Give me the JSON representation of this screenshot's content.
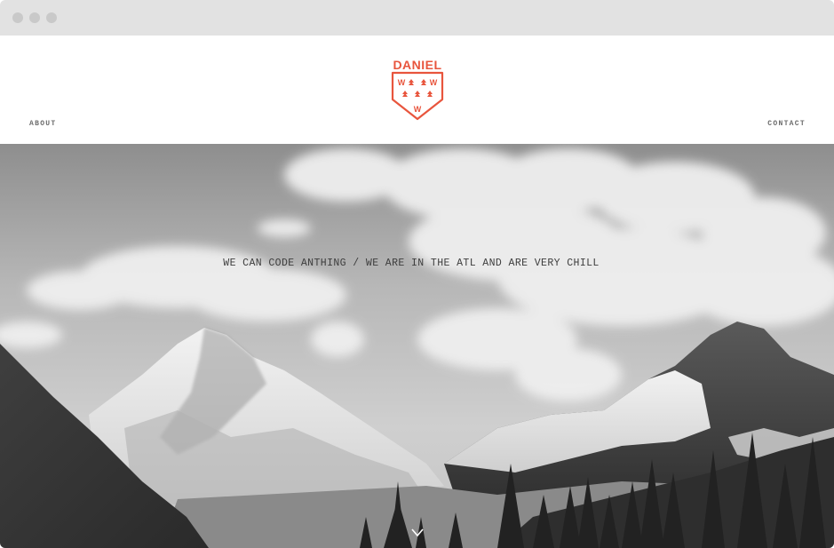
{
  "browser": {
    "controls": [
      "close",
      "minimize",
      "maximize"
    ]
  },
  "header": {
    "logo_text": "DANIEL",
    "logo_letters": [
      "W",
      "W",
      "W"
    ],
    "logo_color": "#e8553d",
    "nav_left": "ABOUT",
    "nav_right": "CONTACT"
  },
  "hero": {
    "tagline": "WE CAN CODE ANTHING / WE ARE IN THE ATL AND ARE VERY CHILL",
    "scroll_icon": "chevron-down-icon",
    "background": "black-and-white mountain landscape with clouds"
  }
}
